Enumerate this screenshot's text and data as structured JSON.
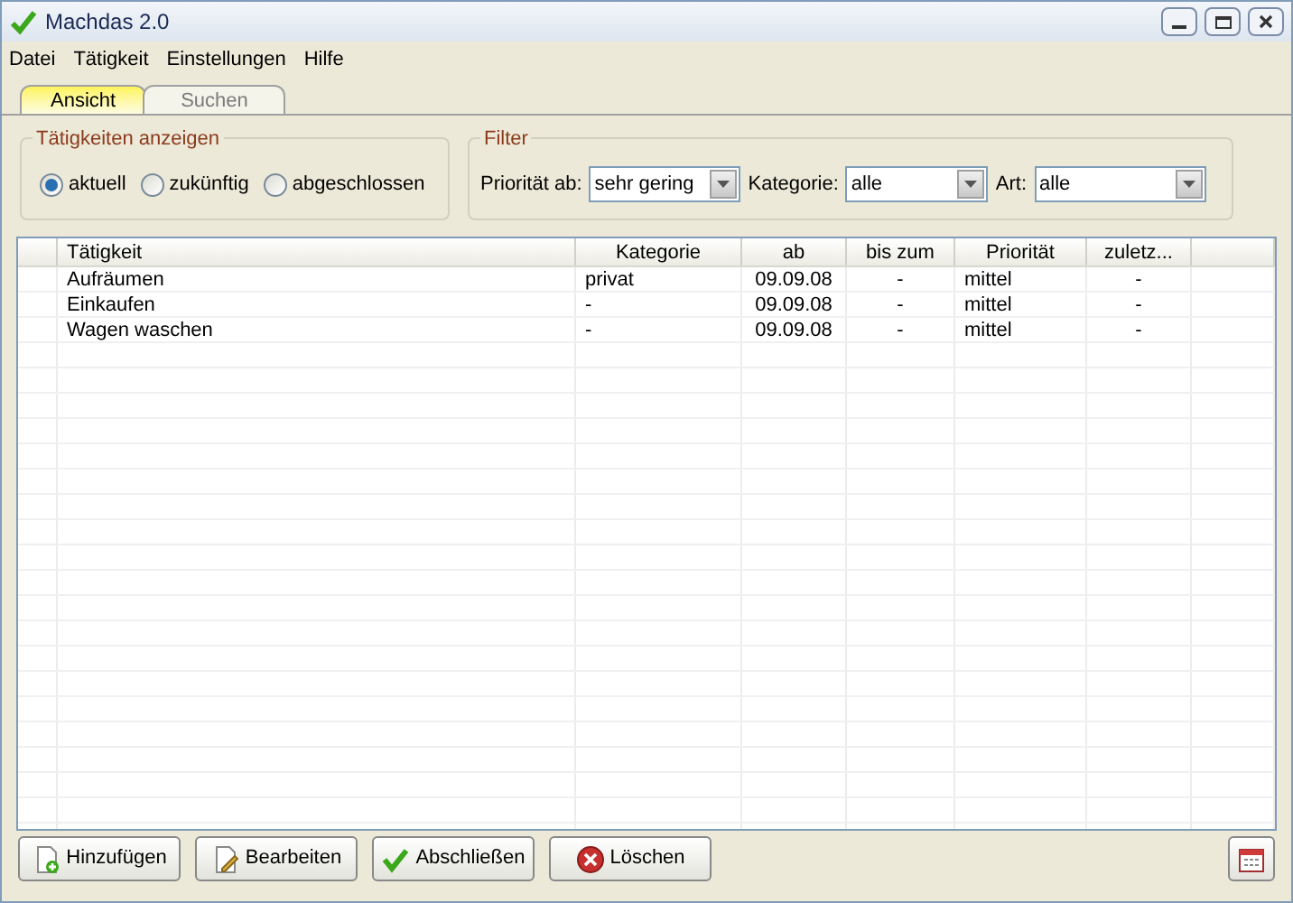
{
  "window": {
    "title": "Machdas 2.0"
  },
  "menu": [
    "Datei",
    "Tätigkeit",
    "Einstellungen",
    "Hilfe"
  ],
  "tabs": [
    {
      "label": "Ansicht",
      "selected": true
    },
    {
      "label": "Suchen",
      "selected": false
    }
  ],
  "show_group": {
    "title": "Tätigkeiten anzeigen",
    "options": [
      {
        "label": "aktuell",
        "selected": true
      },
      {
        "label": "zukünftig",
        "selected": false
      },
      {
        "label": "abgeschlossen",
        "selected": false
      }
    ]
  },
  "filter_group": {
    "title": "Filter",
    "fields": [
      {
        "label": "Priorität ab:",
        "value": "sehr gering"
      },
      {
        "label": "Kategorie:",
        "value": "alle"
      },
      {
        "label": "Art:",
        "value": "alle"
      }
    ]
  },
  "table": {
    "columns": [
      "Tätigkeit",
      "Kategorie",
      "ab",
      "bis zum",
      "Priorität",
      "zuletz..."
    ],
    "rows": [
      [
        "Aufräumen",
        "privat",
        "09.09.08",
        "-",
        "mittel",
        "-"
      ],
      [
        "Einkaufen",
        "-",
        "09.09.08",
        "-",
        "mittel",
        "-"
      ],
      [
        "Wagen waschen",
        "-",
        "09.09.08",
        "-",
        "mittel",
        "-"
      ]
    ]
  },
  "buttons": [
    {
      "kind": "add",
      "label": "Hinzufügen"
    },
    {
      "kind": "edit",
      "label": "Bearbeiten"
    },
    {
      "kind": "done",
      "label": "Abschließen"
    },
    {
      "kind": "delete",
      "label": "Löschen"
    }
  ]
}
